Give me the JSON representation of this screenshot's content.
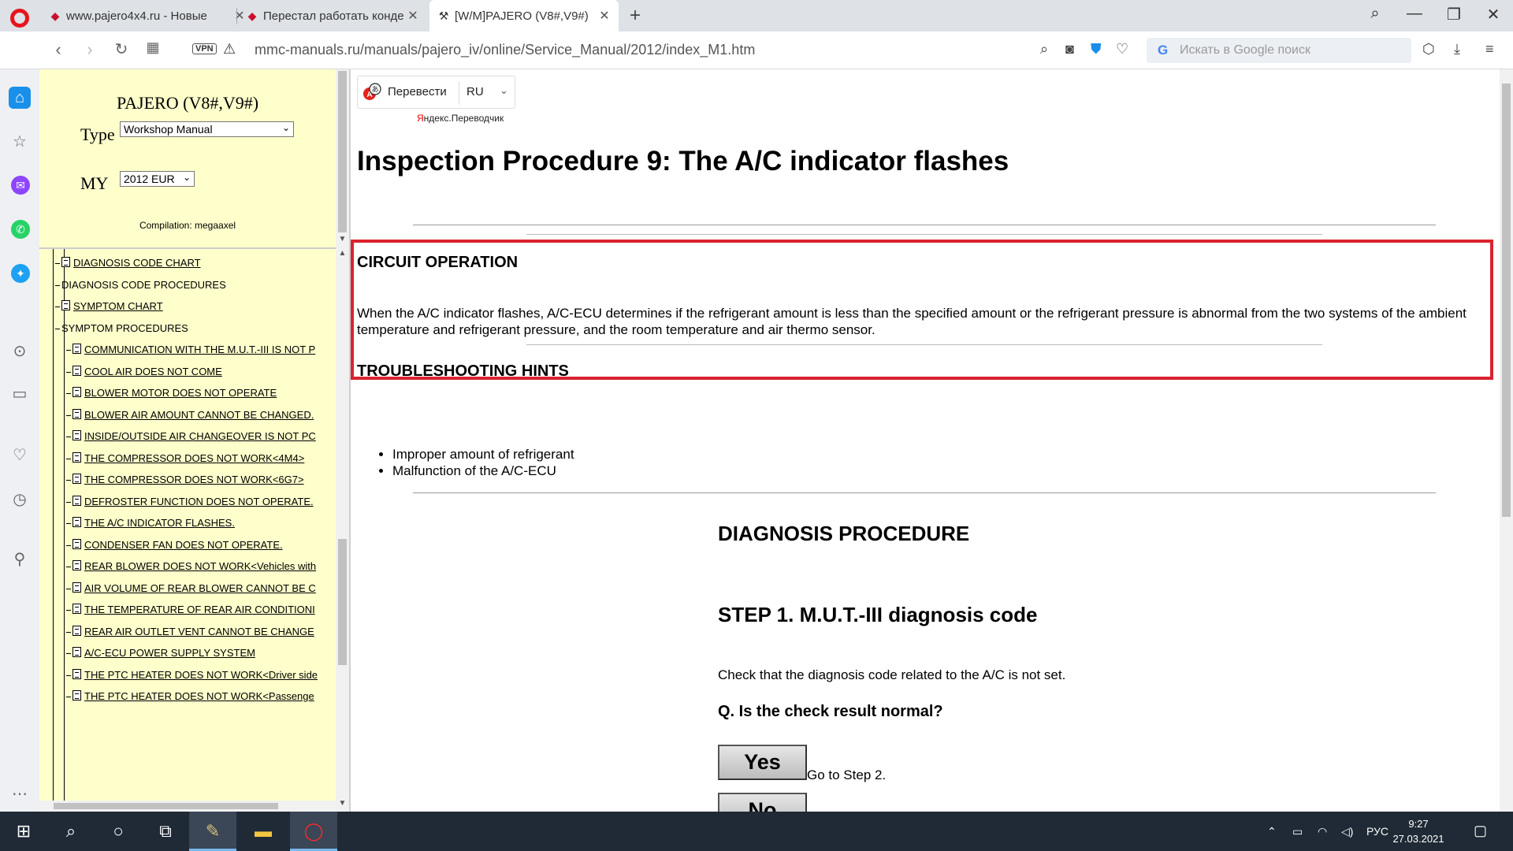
{
  "browser": {
    "tabs": [
      {
        "title": "www.pajero4x4.ru - Новые"
      },
      {
        "title": "Перестал работать конде"
      },
      {
        "title": "[W/M]PAJERO (V8#,V9#)"
      }
    ],
    "new_tab": "+",
    "vpn": "VPN",
    "url": "mmc-manuals.ru/manuals/pajero_iv/online/Service_Manual/2012/index_M1.htm",
    "search_placeholder": "Искать в Google поиск",
    "search_g": "G"
  },
  "left_frame": {
    "title": "PAJERO (V8#,V9#)",
    "type_label": "Type",
    "type_value": "Workshop Manual",
    "my_label": "MY",
    "my_value": "2012 EUR",
    "compilation": "Compilation: megaaxel",
    "tree": [
      {
        "label": "DIAGNOSIS CODE CHART",
        "doc": true
      },
      {
        "label": "DIAGNOSIS CODE PROCEDURES",
        "doc": false
      },
      {
        "label": "SYMPTOM CHART",
        "doc": true
      },
      {
        "label": "SYMPTOM PROCEDURES",
        "doc": false
      },
      {
        "label": "COMMUNICATION WITH THE M.U.T.-III IS NOT P",
        "doc": true
      },
      {
        "label": "COOL AIR DOES NOT COME",
        "doc": true
      },
      {
        "label": "BLOWER MOTOR DOES NOT OPERATE",
        "doc": true
      },
      {
        "label": "BLOWER AIR AMOUNT CANNOT BE CHANGED.",
        "doc": true
      },
      {
        "label": "INSIDE/OUTSIDE AIR CHANGEOVER IS NOT PC",
        "doc": true
      },
      {
        "label": "THE COMPRESSOR DOES NOT WORK<4M4>",
        "doc": true
      },
      {
        "label": "THE COMPRESSOR DOES NOT WORK<6G7>",
        "doc": true
      },
      {
        "label": "DEFROSTER FUNCTION DOES NOT OPERATE.",
        "doc": true
      },
      {
        "label": "THE A/C INDICATOR FLASHES.",
        "doc": true
      },
      {
        "label": "CONDENSER FAN DOES NOT OPERATE.",
        "doc": true
      },
      {
        "label": "REAR BLOWER DOES NOT WORK<Vehicles with",
        "doc": true
      },
      {
        "label": "AIR VOLUME OF REAR BLOWER CANNOT BE C",
        "doc": true
      },
      {
        "label": "THE TEMPERATURE OF REAR AIR CONDITIONI",
        "doc": true
      },
      {
        "label": "REAR AIR OUTLET VENT CANNOT BE CHANGE",
        "doc": true
      },
      {
        "label": "A/C-ECU POWER SUPPLY SYSTEM",
        "doc": true
      },
      {
        "label": "THE PTC HEATER DOES NOT WORK<Driver side",
        "doc": true
      },
      {
        "label": "THE PTC HEATER DOES NOT WORK<Passenge",
        "doc": true
      }
    ]
  },
  "translator": {
    "button": "Перевести",
    "lang": "RU",
    "brand_first": "Я",
    "brand_rest": "ндекс.Переводчик"
  },
  "content": {
    "title": "Inspection Procedure 9: The A/C indicator flashes",
    "circuit_heading": "CIRCUIT OPERATION",
    "circuit_text": "When the A/C indicator flashes, A/C-ECU determines if the refrigerant amount is less than the specified amount or the refrigerant pressure is abnormal from the two systems of the ambient temperature and refrigerant pressure, and the room temperature and air thermo sensor.",
    "hints_heading": "TROUBLESHOOTING HINTS",
    "hints": [
      "Improper amount of refrigerant",
      "Malfunction of the A/C-ECU"
    ],
    "diag_heading": "DIAGNOSIS PROCEDURE",
    "step_heading": "STEP 1. M.U.T.-III diagnosis code",
    "step_text": "Check that the diagnosis code related to the A/C is not set.",
    "question": "Q. Is the check result normal?",
    "yes_label": "Yes",
    "yes_goto": "Go to Step 2.",
    "no_label": "No"
  },
  "taskbar": {
    "lang": "РУС",
    "time": "9:27",
    "date": "27.03.2021"
  },
  "colors": {
    "accent_red": "#d9232e",
    "left_frame_bg": "#ffffcc",
    "sidebar_home": "#1a8fe9",
    "taskbar_bg": "#1f2a36"
  }
}
